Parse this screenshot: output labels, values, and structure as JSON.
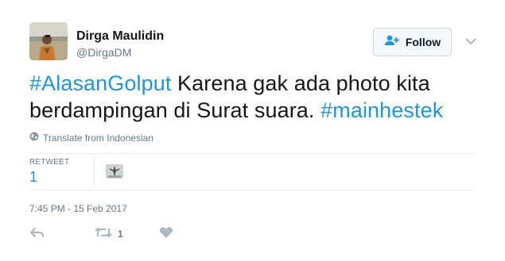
{
  "author": {
    "name": "Dirga Maulidin",
    "handle": "@DirgaDM"
  },
  "follow": {
    "label": "Follow"
  },
  "tweet": {
    "hashtag_1": "#AlasanGolput",
    "text_main": " Karena gak ada photo kita berdampingan di Surat suara. ",
    "hashtag_2": "#mainhestek"
  },
  "translate": {
    "label": "Translate from Indonesian"
  },
  "stats": {
    "retweet_label": "RETWEET",
    "retweet_count": "1"
  },
  "timestamp": "7:45 PM - 15 Feb 2017",
  "actions": {
    "retweet_count": "1"
  },
  "colors": {
    "accent": "#1b95e0",
    "muted": "#657786",
    "text": "#14171a",
    "border": "#e6ecf0"
  },
  "icons": [
    "globe-icon",
    "follow-user-icon",
    "chevron-down-icon",
    "reply-icon",
    "retweet-icon",
    "like-heart-icon"
  ]
}
